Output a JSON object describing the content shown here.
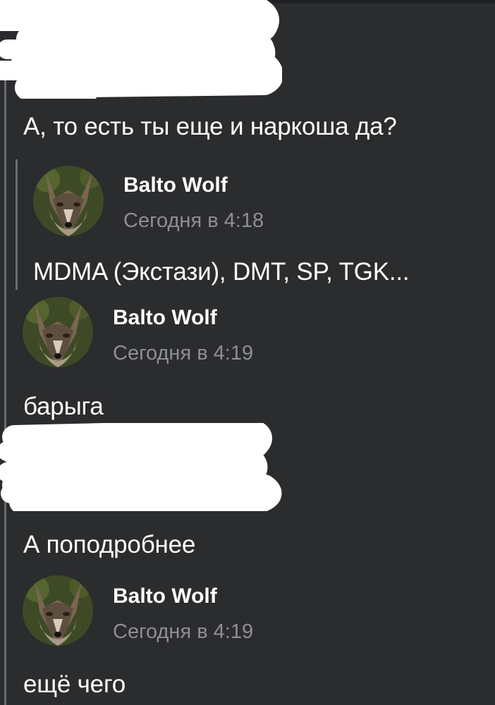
{
  "colors": {
    "background": "#2b2c2e",
    "text": "#ffffff",
    "timestamp": "#8e8f92",
    "quote_bar": "#6b6c6f",
    "redaction": "#ffffff"
  },
  "messages": [
    {
      "author": "",
      "redacted": true,
      "text": "А, то есть ты еще и наркоша да?"
    },
    {
      "author": "Balto Wolf",
      "time": "Сегодня в 4:18",
      "avatar_icon": "wolf-avatar-icon",
      "text": "MDMA (Экстази), DMT, SP, TGK..."
    },
    {
      "author": "Balto Wolf",
      "time": "Сегодня в 4:19",
      "avatar_icon": "wolf-avatar-icon",
      "text": "барыга"
    },
    {
      "author": "",
      "redacted": true,
      "text": "А поподробнее"
    },
    {
      "author": "Balto Wolf",
      "time": "Сегодня в 4:19",
      "avatar_icon": "wolf-avatar-icon",
      "text": "ещё чего"
    }
  ]
}
